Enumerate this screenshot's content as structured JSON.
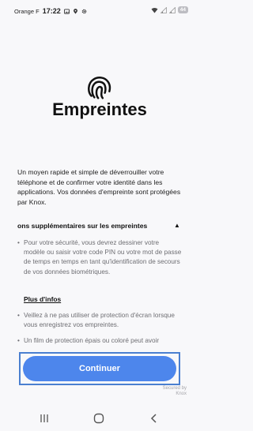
{
  "status_bar": {
    "carrier": "Orange F",
    "time": "17:22",
    "battery": "44",
    "icons": [
      "image-icon",
      "location-icon",
      "settings-icon",
      "wifi-icon",
      "signal-icon",
      "signal-icon-2"
    ]
  },
  "header": {
    "icon": "fingerprint-icon",
    "title": "Empreintes"
  },
  "description": "Un moyen rapide et simple de déverrouiller votre téléphone et de confirmer votre identité dans les applications. Vos données d'empreinte sont protégées par Knox.",
  "security_section": {
    "title": "ons supplémentaires sur les empreintes",
    "expanded_icon": "collapse-arrow-icon",
    "bullets": [
      "Pour votre sécurité, vous devrez dessiner votre modèle ou saisir votre code PIN ou votre mot de passe de temps en temps en tant qu'identification de secours de vos données biométriques.",
      "Veillez à ne pas utiliser de protection d'écran lorsque vous enregistrez vos empreintes.",
      "Un film de protection épais ou coloré peut avoir"
    ],
    "more_link": "Plus d'infos"
  },
  "primary_button": "Continuer",
  "knox_badge": [
    "Secured by",
    "Knox"
  ],
  "nav_bar": [
    "recent-apps-icon",
    "home-icon",
    "back-icon"
  ],
  "colors": {
    "accent": "#4d86ec",
    "focus_ring": "#4a7fd0",
    "background": "#f8f8fa"
  }
}
